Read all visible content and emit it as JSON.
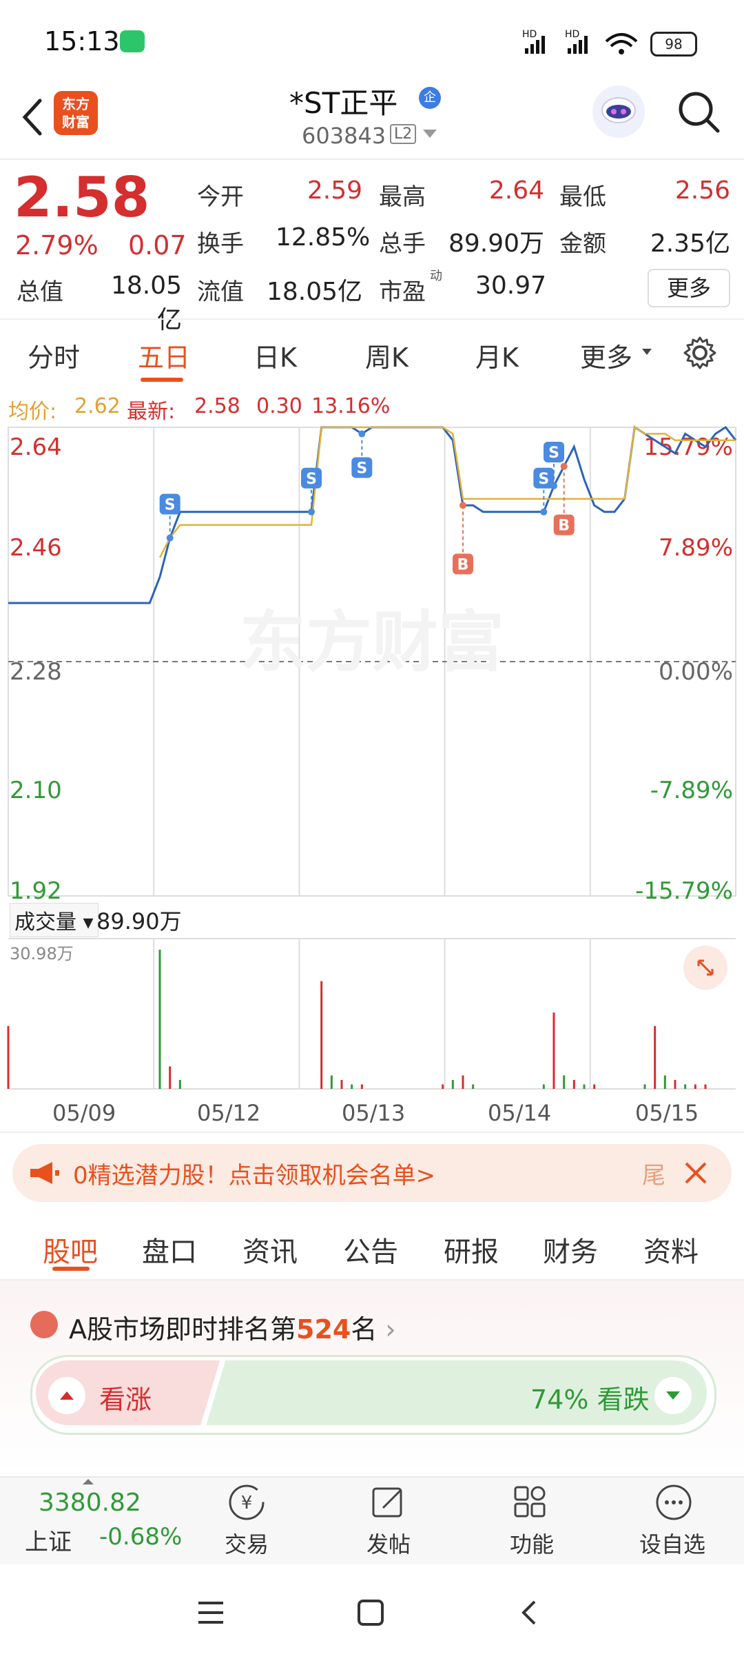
{
  "status_bar": {
    "time": "15:13",
    "battery": "98"
  },
  "header": {
    "logo_text": "东方\n财富",
    "stock_name": "*ST正平",
    "badge": "企",
    "stock_code": "603843",
    "level": "L2"
  },
  "quote": {
    "price": "2.58",
    "change_pct": "2.79%",
    "change": "0.07",
    "stats": [
      {
        "label": "今开",
        "value": "2.59",
        "color": "red"
      },
      {
        "label": "最高",
        "value": "2.64",
        "color": "red"
      },
      {
        "label": "最低",
        "value": "2.56",
        "color": "red"
      },
      {
        "label": "换手",
        "value": "12.85%",
        "color": "dark"
      },
      {
        "label": "总手",
        "value": "89.90万",
        "color": "dark"
      },
      {
        "label": "金额",
        "value": "2.35亿",
        "color": "dark"
      },
      {
        "label": "总值",
        "value": "18.05亿",
        "color": "dark"
      },
      {
        "label": "流值",
        "value": "18.05亿",
        "color": "dark"
      },
      {
        "label": "市盈",
        "value": "30.97",
        "color": "dark"
      }
    ],
    "pe_sup": "动",
    "more_label": "更多"
  },
  "period_tabs": [
    "分时",
    "五日",
    "日K",
    "周K",
    "月K",
    "更多"
  ],
  "active_period": "五日",
  "info_line": {
    "avg_label": "均价:",
    "avg": "2.62",
    "latest_label": "最新:",
    "latest": "2.58",
    "change": "0.30",
    "amplitude": "13.16%"
  },
  "chart_data": {
    "type": "line",
    "title": "",
    "x_dates": [
      "05/09",
      "05/12",
      "05/13",
      "05/14",
      "05/15"
    ],
    "y_ticks_left": [
      "2.64",
      "2.46",
      "2.28",
      "2.10",
      "1.92"
    ],
    "y_ticks_right": [
      "15.79%",
      "7.89%",
      "0.00%",
      "-7.89%",
      "-15.79%"
    ],
    "ylim": [
      1.92,
      2.64
    ],
    "prev_close": 2.28,
    "series": [
      {
        "name": "最新",
        "color": "#2b63b8",
        "values": [
          2.37,
          2.37,
          2.37,
          2.37,
          2.37,
          2.37,
          2.37,
          2.37,
          2.37,
          2.37,
          2.37,
          2.37,
          2.37,
          2.37,
          2.37,
          2.41,
          2.47,
          2.51,
          2.51,
          2.51,
          2.51,
          2.51,
          2.51,
          2.51,
          2.51,
          2.51,
          2.51,
          2.51,
          2.51,
          2.51,
          2.51,
          2.64,
          2.64,
          2.64,
          2.64,
          2.63,
          2.64,
          2.64,
          2.64,
          2.64,
          2.64,
          2.64,
          2.64,
          2.64,
          2.62,
          2.52,
          2.52,
          2.51,
          2.51,
          2.51,
          2.51,
          2.51,
          2.51,
          2.51,
          2.55,
          2.58,
          2.61,
          2.56,
          2.52,
          2.51,
          2.51,
          2.53,
          2.64,
          2.63,
          2.62,
          2.61,
          2.6,
          2.63,
          2.62,
          2.61,
          2.63,
          2.64,
          2.62
        ]
      },
      {
        "name": "均价",
        "color": "#e0b23a",
        "values": [
          null,
          null,
          null,
          null,
          null,
          null,
          null,
          null,
          null,
          null,
          null,
          null,
          null,
          null,
          null,
          2.44,
          2.47,
          2.49,
          2.49,
          2.49,
          2.49,
          2.49,
          2.49,
          2.49,
          2.49,
          2.49,
          2.49,
          2.49,
          2.49,
          2.49,
          2.49,
          2.64,
          2.64,
          2.64,
          2.64,
          2.64,
          2.64,
          2.64,
          2.64,
          2.64,
          2.64,
          2.64,
          2.64,
          2.64,
          2.63,
          2.53,
          2.53,
          2.53,
          2.53,
          2.53,
          2.53,
          2.53,
          2.53,
          2.53,
          2.53,
          2.53,
          2.53,
          2.53,
          2.53,
          2.53,
          2.53,
          2.53,
          2.64,
          2.63,
          2.63,
          2.63,
          2.62,
          2.62,
          2.62,
          2.62,
          2.62,
          2.62,
          2.62
        ]
      }
    ],
    "markers": [
      {
        "type": "S",
        "x_index": 16
      },
      {
        "type": "S",
        "x_index": 30
      },
      {
        "type": "S",
        "x_index": 35
      },
      {
        "type": "B",
        "x_index": 45
      },
      {
        "type": "S",
        "x_index": 53
      },
      {
        "type": "S",
        "x_index": 54
      },
      {
        "type": "B",
        "x_index": 55
      }
    ],
    "watermark": "东方财富",
    "volume": {
      "label": "成交量",
      "total": "89.90万",
      "max_label": "30.98万",
      "values": [
        14,
        0,
        0,
        0,
        0,
        0,
        0,
        0,
        0,
        0,
        0,
        0,
        0,
        0,
        0,
        31,
        5,
        2,
        0,
        0,
        0,
        0,
        0,
        0,
        0,
        0,
        0,
        0,
        0,
        0,
        0,
        24,
        3,
        2,
        1,
        1,
        0,
        0,
        0,
        0,
        0,
        0,
        0,
        1,
        2,
        3,
        1,
        0,
        0,
        0,
        0,
        0,
        0,
        1,
        17,
        3,
        2,
        1,
        1,
        0,
        0,
        0,
        0,
        1,
        14,
        3,
        2,
        1,
        1,
        1,
        0,
        0,
        0
      ],
      "colors": [
        "r",
        "r",
        "r",
        "r",
        "r",
        "r",
        "r",
        "r",
        "r",
        "r",
        "r",
        "r",
        "r",
        "r",
        "r",
        "g",
        "r",
        "g",
        "r",
        "r",
        "r",
        "r",
        "r",
        "r",
        "r",
        "r",
        "r",
        "r",
        "r",
        "r",
        "r",
        "r",
        "g",
        "r",
        "g",
        "r",
        "r",
        "r",
        "r",
        "r",
        "r",
        "r",
        "r",
        "r",
        "g",
        "r",
        "g",
        "r",
        "r",
        "r",
        "r",
        "r",
        "r",
        "g",
        "r",
        "g",
        "r",
        "g",
        "r",
        "r",
        "r",
        "r",
        "r",
        "g",
        "r",
        "g",
        "r",
        "g",
        "r",
        "r",
        "r",
        "r",
        "r"
      ]
    }
  },
  "banner": {
    "text": "0精选潜力股！点击领取机会名单>",
    "end_text": "尾"
  },
  "sub_tabs": [
    "股吧",
    "盘口",
    "资讯",
    "公告",
    "研报",
    "财务",
    "资料"
  ],
  "active_sub_tab": "股吧",
  "ranking": {
    "prefix": "A股市场即时排名第",
    "rank": "524",
    "suffix": "名"
  },
  "sentiment": {
    "up_label": "看涨",
    "down_pct": "74%",
    "down_label": "看跌",
    "down_fraction": 0.74
  },
  "bottom_bar": {
    "index_value": "3380.82",
    "index_name": "上证",
    "index_change": "-0.68%",
    "items": [
      "交易",
      "发帖",
      "功能",
      "设自选"
    ]
  }
}
